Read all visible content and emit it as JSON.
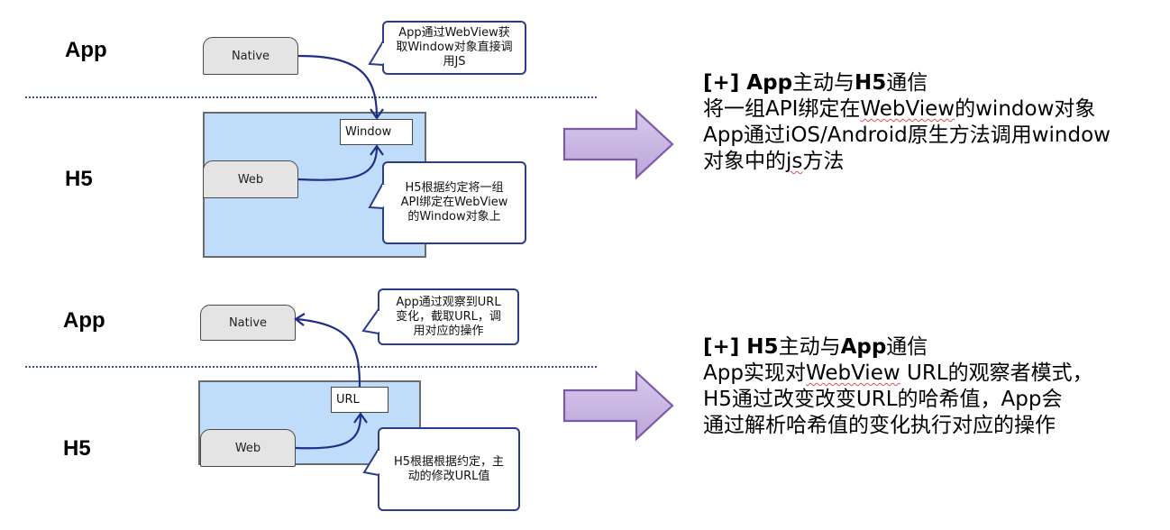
{
  "diagrams": [
    {
      "id": "app-to-h5",
      "layer_labels": {
        "top": "App",
        "bottom": "H5"
      },
      "native_label": "Native",
      "web_label": "Web",
      "target_label": "Window",
      "callout_top": "App通过WebView获取Window对象直接调用JS",
      "callout_top_lines": [
        "App通过WebView获",
        "取Window对象直接调",
        "用JS"
      ],
      "callout_bottom_lines": [
        "H5根据约定将一组",
        "API绑定在WebView",
        "的Window对象上"
      ],
      "flow_direction": "native-to-target"
    },
    {
      "id": "h5-to-app",
      "layer_labels": {
        "top": "App",
        "bottom": "H5"
      },
      "native_label": "Native",
      "web_label": "Web",
      "target_label": "URL",
      "callout_top_lines": [
        "App通过观察到URL",
        "变化，截取URL，调",
        "用对应的操作"
      ],
      "callout_bottom_lines": [
        "H5根据根据约定，主",
        "动的修改URL值"
      ],
      "flow_direction": "target-to-native"
    }
  ],
  "descriptions": [
    {
      "heading_parts": [
        {
          "text": "[+] App",
          "bold": true
        },
        {
          "text": "主动与",
          "bold": false
        },
        {
          "text": "H5",
          "bold": true
        },
        {
          "text": "通信",
          "bold": false
        }
      ],
      "lines": [
        [
          {
            "text": "将一组API绑定在"
          },
          {
            "text": "WebView",
            "squiggle": true
          },
          {
            "text": "的window对象"
          }
        ],
        [
          {
            "text": "App通过iOS/Android原生方法调用window"
          }
        ],
        [
          {
            "text": "对象中的"
          },
          {
            "text": "js",
            "squiggle": true
          },
          {
            "text": "方法"
          }
        ]
      ]
    },
    {
      "heading_parts": [
        {
          "text": "[+] H5",
          "bold": true
        },
        {
          "text": "主动与",
          "bold": false
        },
        {
          "text": "App",
          "bold": true
        },
        {
          "text": "通信",
          "bold": false
        }
      ],
      "lines": [
        [
          {
            "text": "App实现对"
          },
          {
            "text": "WebView",
            "squiggle": true
          },
          {
            "text": " URL的观察者模式，"
          }
        ],
        [
          {
            "text": "H5通过改变改变URL的哈希值，App会"
          }
        ],
        [
          {
            "text": "通过解析哈希值的变化执行对应的操作"
          }
        ]
      ]
    }
  ],
  "colors": {
    "flow_line": "#1f2f86",
    "divider": "#3b4a9a",
    "webview_fill": "#bfdcfb",
    "component_fill": "#e4e4e4",
    "callout_border": "#2b3c8c",
    "big_arrow_fill": "#cbb8e0",
    "big_arrow_stroke": "#7a5aa6"
  }
}
